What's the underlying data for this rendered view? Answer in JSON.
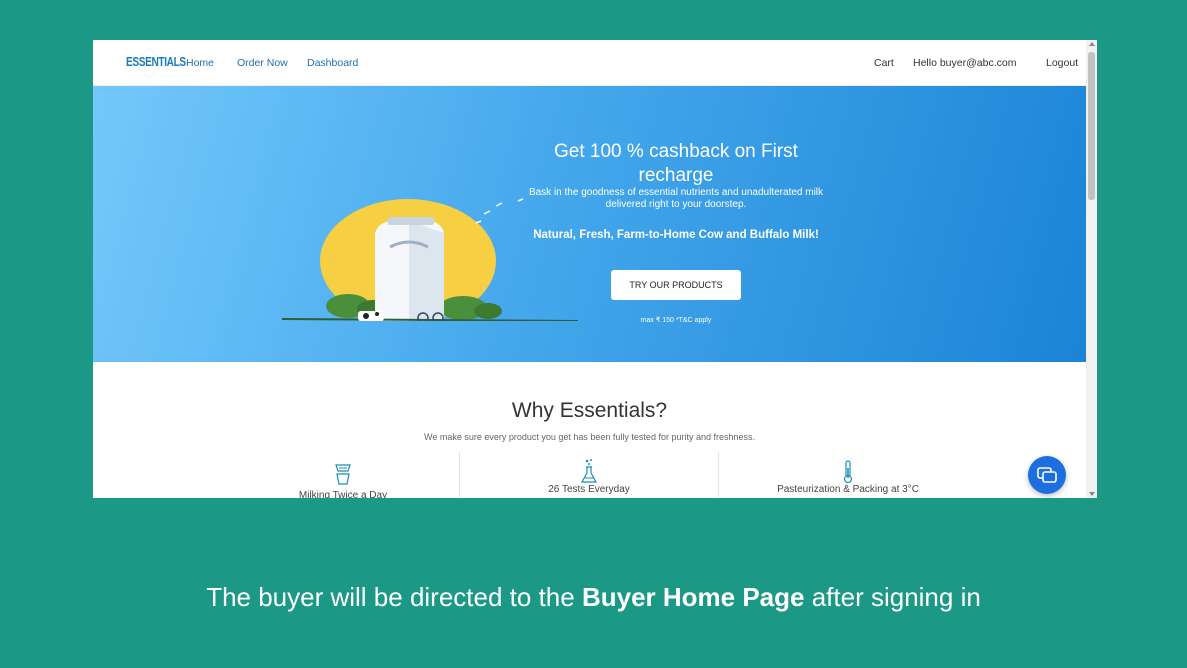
{
  "nav": {
    "logo": "ESSENTIALS",
    "links": [
      "Home",
      "Order Now",
      "Dashboard"
    ],
    "cart": "Cart",
    "greeting": "Hello buyer@abc.com",
    "logout": "Logout"
  },
  "hero": {
    "title": "Get 100 % cashback on First recharge",
    "subtitle": "Bask in the goodness of essential nutrients and unadulterated milk delivered right to your doorstep.",
    "tagline": "Natural, Fresh, Farm-to-Home Cow and Buffalo Milk!",
    "cta": "TRY OUR PRODUCTS",
    "fine_print": "max ₹ 150 *T&C apply"
  },
  "why": {
    "title": "Why Essentials?",
    "subtitle": "We make sure every product you get has been fully tested for purity and freshness.",
    "features": [
      {
        "label": "Milking Twice a Day",
        "icon": "milk-pail-icon"
      },
      {
        "label": "26 Tests Everyday",
        "icon": "lab-flask-icon"
      },
      {
        "label": "Pasteurization & Packing at 3°C",
        "icon": "thermometer-icon"
      }
    ]
  },
  "chat": {
    "icon": "chat-bubbles-icon"
  },
  "caption": {
    "before": "The buyer will be directed to the ",
    "bold": "Buyer Home Page",
    "after": " after signing in"
  },
  "colors": {
    "background": "#1b9886",
    "hero_start": "#74c8fb",
    "hero_end": "#1b84d6",
    "link": "#1c6fb0",
    "chat": "#1d6fe0"
  }
}
